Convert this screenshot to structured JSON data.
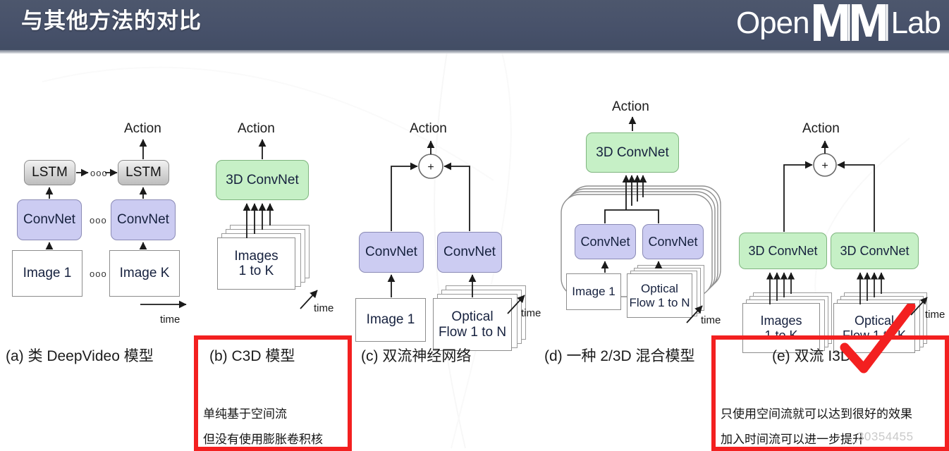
{
  "header": {
    "title": "与其他方法的对比",
    "logo": {
      "left_text": "Open",
      "right_text": "Lab",
      "mark_name": "openmmlab-m-mark"
    },
    "bg_color": "#47516a"
  },
  "labels": {
    "action": "Action",
    "time": "time",
    "plus": "+",
    "ellipsis": "ooo"
  },
  "panels": [
    {
      "id": "a",
      "caption": "(a) 类 DeepVideo 模型",
      "blocks": {
        "lstm_1": "LSTM",
        "lstm_k": "LSTM",
        "convnet_1": "ConvNet",
        "convnet_k": "ConvNet",
        "image_1": "Image 1",
        "image_k": "Image K",
        "action": "Action",
        "time": "time"
      }
    },
    {
      "id": "b",
      "caption": "(b) C3D 模型",
      "blocks": {
        "conv3d": "3D ConvNet",
        "images": "Images\n1 to K",
        "images_line1": "Images",
        "images_line2": "1 to K",
        "action": "Action",
        "time": "time"
      },
      "annotation": {
        "line1": "单纯基于空间流",
        "line2": "但没有使用膨胀卷积核",
        "highlight_color": "#f32020"
      }
    },
    {
      "id": "c",
      "caption": "(c) 双流神经网络",
      "blocks": {
        "convnet_left": "ConvNet",
        "convnet_right": "ConvNet",
        "image_1": "Image 1",
        "flow_line1": "Optical",
        "flow_line2": "Flow 1 to N",
        "action": "Action",
        "time": "time"
      }
    },
    {
      "id": "d",
      "caption": "(d) 一种 2/3D 混合模型",
      "blocks": {
        "conv3d": "3D ConvNet",
        "convnet_left": "ConvNet",
        "convnet_right": "ConvNet",
        "image_1": "Image 1",
        "flow_line1": "Optical",
        "flow_line2": "Flow 1 to N",
        "action": "Action",
        "time": "time"
      }
    },
    {
      "id": "e",
      "caption": "(e) 双流 I3D",
      "blocks": {
        "conv3d_left": "3D ConvNet",
        "conv3d_right": "3D ConvNet",
        "images_line1": "Images",
        "images_line2": "1 to K",
        "flow_line1": "Optical",
        "flow_line2": "Flow 1 to K",
        "action": "Action",
        "time": "time"
      },
      "annotation": {
        "line1": "只使用空间流就可以达到很好的效果",
        "line2": "加入时间流可以进一步提升",
        "highlight_color": "#f32020",
        "check_mark": "check-mark"
      }
    }
  ],
  "watermark": "_30354455",
  "colors": {
    "convnet_fill": "#ccccf2",
    "conv3d_fill": "#c6f0c6",
    "lstm_fill": "#d9d9d9",
    "image_fill": "#ffffff",
    "highlight": "#f32020",
    "header": "#47516a"
  }
}
